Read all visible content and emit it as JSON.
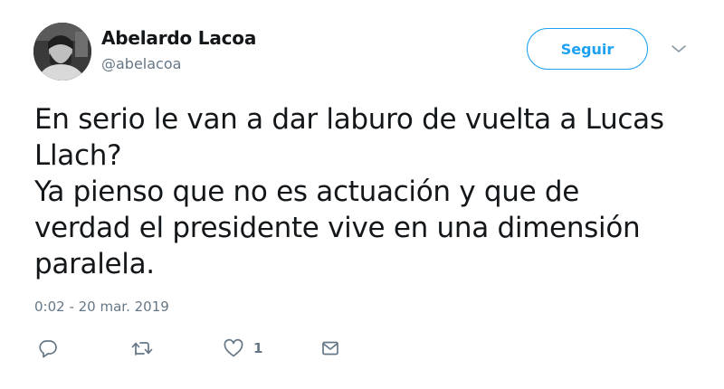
{
  "author": {
    "display_name": "Abelardo Lacoa",
    "handle": "@abelacoa"
  },
  "follow_button": {
    "label": "Seguir"
  },
  "tweet": {
    "lines": [
      "En serio le van a dar laburo de vuelta a Lucas",
      "Llach?",
      "Ya pienso que no es actuación y que de",
      "verdad el presidente vive en una dimensión",
      "paralela."
    ],
    "timestamp": "0:02 - 20 mar. 2019"
  },
  "actions": {
    "reply_icon": "reply-icon",
    "retweet_icon": "retweet-icon",
    "like_icon": "like-icon",
    "like_count": "1",
    "dm_icon": "direct-message-icon"
  },
  "colors": {
    "accent": "#1da1f2",
    "text": "#14171a",
    "secondary": "#657786"
  }
}
